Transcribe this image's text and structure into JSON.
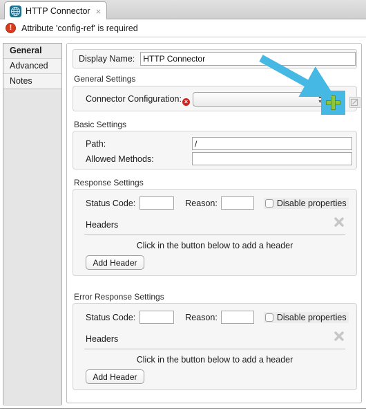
{
  "window": {
    "tab": {
      "label": "HTTP Connector",
      "icon": "globe-icon",
      "close": "×"
    }
  },
  "error_banner": {
    "icon": "error-circle-icon",
    "icon_glyph": "!",
    "message": "Attribute 'config-ref' is required",
    "color": "#d93b1e"
  },
  "sidebar": {
    "items": [
      {
        "label": "General",
        "selected": true
      },
      {
        "label": "Advanced",
        "selected": false
      },
      {
        "label": "Notes",
        "selected": false
      }
    ]
  },
  "display_name": {
    "label": "Display Name:",
    "value": "HTTP Connector",
    "placeholder": ""
  },
  "general_settings": {
    "title": "General Settings",
    "connector_configuration": {
      "label": "Connector Configuration:",
      "error_badge": "×",
      "selected_value": "",
      "options": [],
      "add_button_name": "add-configuration-button",
      "edit_button_name": "edit-configuration-button"
    }
  },
  "basic_settings": {
    "title": "Basic Settings",
    "fields": [
      {
        "label": "Path:",
        "value": "/"
      },
      {
        "label": "Allowed Methods:",
        "value": ""
      }
    ]
  },
  "response_settings": {
    "title": "Response Settings",
    "status_code_label": "Status Code:",
    "status_code_value": "",
    "reason_label": "Reason:",
    "reason_value": "",
    "disable_properties_label": "Disable properties",
    "disable_properties_checked": false,
    "headers_label": "Headers",
    "headers_hint": "Click in the button below to add a header",
    "add_header_label": "Add Header",
    "delete_icon": "delete-x-icon"
  },
  "error_response_settings": {
    "title": "Error Response Settings",
    "status_code_label": "Status Code:",
    "status_code_value": "",
    "reason_label": "Reason:",
    "reason_value": "",
    "disable_properties_label": "Disable properties",
    "disable_properties_checked": false,
    "headers_label": "Headers",
    "headers_hint": "Click in the button below to add a header",
    "add_header_label": "Add Header",
    "delete_icon": "delete-x-icon"
  },
  "annotation": {
    "arrow_color": "#45b8e4",
    "highlight_color": "#45b8e4",
    "target": "add-configuration-button"
  }
}
